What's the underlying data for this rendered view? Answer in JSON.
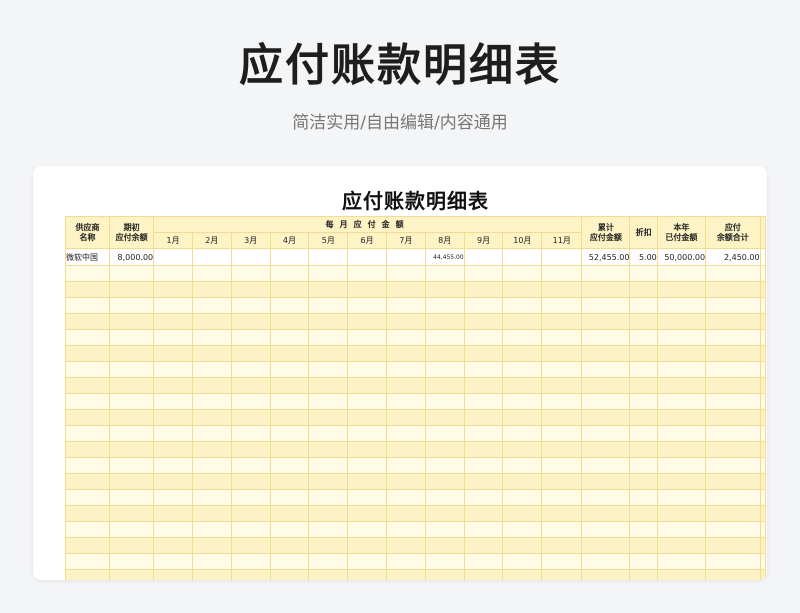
{
  "hero": {
    "title": "应付账款明细表",
    "subtitle": "简洁实用/自由编辑/内容通用"
  },
  "sheet": {
    "title": "应付账款明细表",
    "headers": {
      "supplier": [
        "供应商",
        "名称"
      ],
      "opening": [
        "期初",
        "应付余额"
      ],
      "monthly_group": "每月应付金额",
      "months": [
        "1月",
        "2月",
        "3月",
        "4月",
        "5月",
        "6月",
        "7月",
        "8月",
        "9月",
        "10月",
        "11月"
      ],
      "cumulative": [
        "累计",
        "应付金额"
      ],
      "discount": "折扣",
      "paid": [
        "本年",
        "已付金额"
      ],
      "balance": [
        "应付",
        "余额合计"
      ]
    },
    "rows": [
      {
        "supplier": "微软中国",
        "opening": "8,000.00",
        "months": [
          "",
          "",
          "",
          "",
          "",
          "",
          "",
          "44,455.00",
          "",
          "",
          ""
        ],
        "cumulative": "52,455.00",
        "discount": "5.00",
        "paid": "50,000.00",
        "balance": "2,450.00"
      }
    ]
  },
  "colors": {
    "background": "#f4f5f7",
    "grid_line": "#f1dc92",
    "header_fill": "#fdf3c4",
    "stripe_light": "#fffbe6",
    "stripe_dark": "#fdf2c5"
  }
}
